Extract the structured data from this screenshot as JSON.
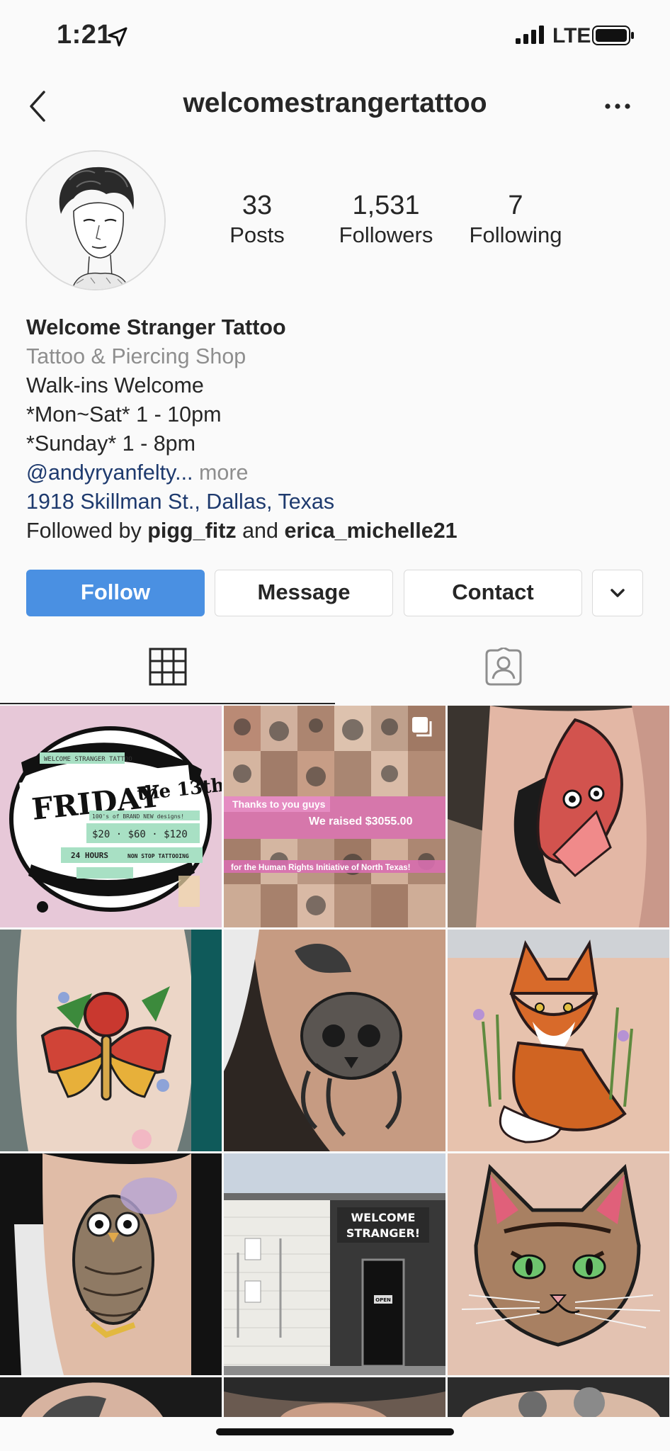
{
  "status_bar": {
    "time": "1:21",
    "network": "LTE"
  },
  "header": {
    "username": "welcomestrangertattoo",
    "back_icon": "chevron-left-icon",
    "more_icon": "more-horizontal-icon"
  },
  "profile": {
    "stats": [
      {
        "value": "33",
        "label": "Posts"
      },
      {
        "value": "1,531",
        "label": "Followers"
      },
      {
        "value": "7",
        "label": "Following"
      }
    ]
  },
  "bio": {
    "name": "Welcome Stranger Tattoo",
    "category": "Tattoo & Piercing Shop",
    "lines": [
      "Walk-ins Welcome",
      "*Mon~Sat* 1 - 10pm",
      "*Sunday* 1 - 8pm"
    ],
    "mention": "@andyryanfelty",
    "ellipsis": "...",
    "more": " more",
    "address": "1918 Skillman St., Dallas, Texas",
    "followed_by_prefix": "Followed by ",
    "followed_by_user1": "pigg_fitz",
    "followed_by_and": " and ",
    "followed_by_user2": "erica_michelle21"
  },
  "buttons": {
    "follow": "Follow",
    "message": "Message",
    "contact": "Contact"
  },
  "tabs": {
    "grid_icon": "grid-icon",
    "tagged_icon": "tagged-person-icon"
  },
  "posts": {
    "post1": {
      "banner": "WELCOME STRANGER TATTOO",
      "headline_1": "FRIDAY",
      "headline_2": "the 13th",
      "brand_new": "100's of BRAND NEW designs!",
      "prices": "$20 · $60 · $120",
      "hours": "24 HOURS",
      "non_stop": "NON STOP TATTOOING"
    },
    "post2": {
      "line1": "Thanks to you guys",
      "line2": "We raised $3055.00",
      "line3": "for the Human Rights Initiative of North Texas!"
    },
    "post8": {
      "sign_line1": "WELCOME",
      "sign_line2": "STRANGER!",
      "open_sign": "OPEN"
    }
  },
  "colors": {
    "follow_button": "#4a90e2",
    "link": "#1e3a6e",
    "muted": "#8e8e8e"
  }
}
